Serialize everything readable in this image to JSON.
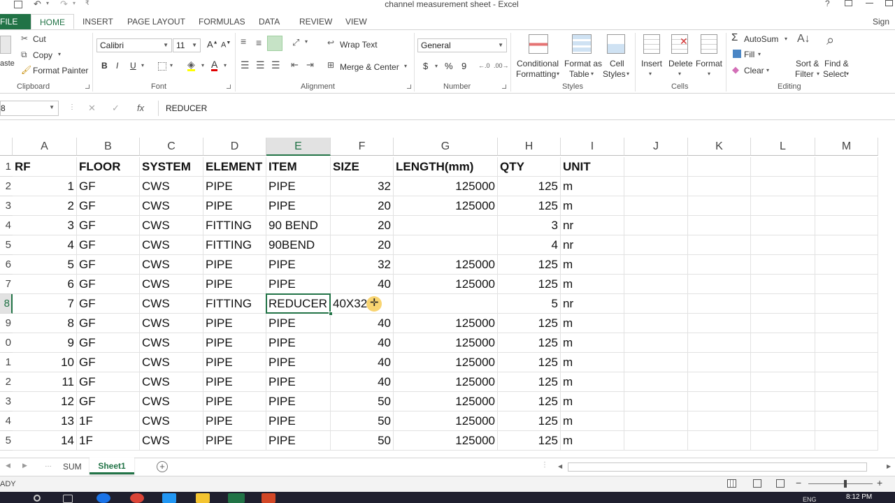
{
  "window": {
    "title": "channel measurement sheet - Excel",
    "signin": "Sign in"
  },
  "ribbon_tabs": [
    "FILE",
    "HOME",
    "INSERT",
    "PAGE LAYOUT",
    "FORMULAS",
    "DATA",
    "REVIEW",
    "VIEW"
  ],
  "clipboard": {
    "cut": "Cut",
    "copy": "Copy",
    "format_painter": "Format Painter",
    "paste_partial": "aste",
    "label": "Clipboard"
  },
  "font": {
    "name": "Calibri",
    "size": "11",
    "bold": "B",
    "italic": "I",
    "underline": "U",
    "label": "Font"
  },
  "alignment": {
    "wrap_text": "Wrap Text",
    "merge_center": "Merge & Center",
    "label": "Alignment"
  },
  "number": {
    "format": "General",
    "currency": "$",
    "percent": "%",
    "comma": "9",
    "label": "Number"
  },
  "styles": {
    "conditional_formatting_1": "Conditional",
    "conditional_formatting_2": "Formatting",
    "format_as_table_1": "Format as",
    "format_as_table_2": "Table",
    "cell_styles_1": "Cell",
    "cell_styles_2": "Styles",
    "label": "Styles"
  },
  "cells": {
    "insert": "Insert",
    "delete": "Delete",
    "format": "Format",
    "label": "Cells"
  },
  "editing": {
    "autosum": "AutoSum",
    "fill": "Fill",
    "clear": "Clear",
    "sort_filter_1": "Sort &",
    "sort_filter_2": "Filter",
    "find_select_1": "Find &",
    "find_select_2": "Select",
    "label": "Editing"
  },
  "formula_bar": {
    "name_box": "8",
    "fx": "fx",
    "content": "REDUCER"
  },
  "columns": [
    "A",
    "B",
    "C",
    "D",
    "E",
    "F",
    "G",
    "H",
    "I",
    "J",
    "K",
    "L",
    "M"
  ],
  "row_numbers": [
    "1",
    "2",
    "3",
    "4",
    "5",
    "6",
    "7",
    "8",
    "9",
    "0",
    "1",
    "2",
    "3",
    "4",
    "5"
  ],
  "rows": [
    [
      "RF",
      "FLOOR",
      "SYSTEM",
      "ELEMENT",
      "ITEM",
      "SIZE",
      "LENGTH(mm)",
      "QTY",
      "UNIT"
    ],
    [
      "1",
      "GF",
      "CWS",
      "PIPE",
      "PIPE",
      "32",
      "125000",
      "125",
      "m"
    ],
    [
      "2",
      "GF",
      "CWS",
      "PIPE",
      "PIPE",
      "20",
      "125000",
      "125",
      "m"
    ],
    [
      "3",
      "GF",
      "CWS",
      "FITTING",
      "90 BEND",
      "20",
      "",
      "3",
      "nr"
    ],
    [
      "4",
      "GF",
      "CWS",
      "FITTING",
      "90BEND",
      "20",
      "",
      "4",
      "nr"
    ],
    [
      "5",
      "GF",
      "CWS",
      "PIPE",
      "PIPE",
      "32",
      "125000",
      "125",
      "m"
    ],
    [
      "6",
      "GF",
      "CWS",
      "PIPE",
      "PIPE",
      "40",
      "125000",
      "125",
      "m"
    ],
    [
      "7",
      "GF",
      "CWS",
      "FITTING",
      "REDUCER",
      "40X32",
      "",
      "5",
      "nr"
    ],
    [
      "8",
      "GF",
      "CWS",
      "PIPE",
      "PIPE",
      "40",
      "125000",
      "125",
      "m"
    ],
    [
      "9",
      "GF",
      "CWS",
      "PIPE",
      "PIPE",
      "40",
      "125000",
      "125",
      "m"
    ],
    [
      "10",
      "GF",
      "CWS",
      "PIPE",
      "PIPE",
      "40",
      "125000",
      "125",
      "m"
    ],
    [
      "11",
      "GF",
      "CWS",
      "PIPE",
      "PIPE",
      "40",
      "125000",
      "125",
      "m"
    ],
    [
      "12",
      "GF",
      "CWS",
      "PIPE",
      "PIPE",
      "50",
      "125000",
      "125",
      "m"
    ],
    [
      "13",
      "1F",
      "CWS",
      "PIPE",
      "PIPE",
      "50",
      "125000",
      "125",
      "m"
    ],
    [
      "14",
      "1F",
      "CWS",
      "PIPE",
      "PIPE",
      "50",
      "125000",
      "125",
      "m"
    ]
  ],
  "sheets": {
    "sum": "SUM",
    "sheet1": "Sheet1"
  },
  "status": {
    "ready": "ADY"
  },
  "taskbar": {
    "time": "8:12 PM",
    "lang": "ENG"
  },
  "colors": {
    "accent": "#217346",
    "selected_header_bg": "#e2e2e2",
    "cursor": "#f5c542"
  }
}
